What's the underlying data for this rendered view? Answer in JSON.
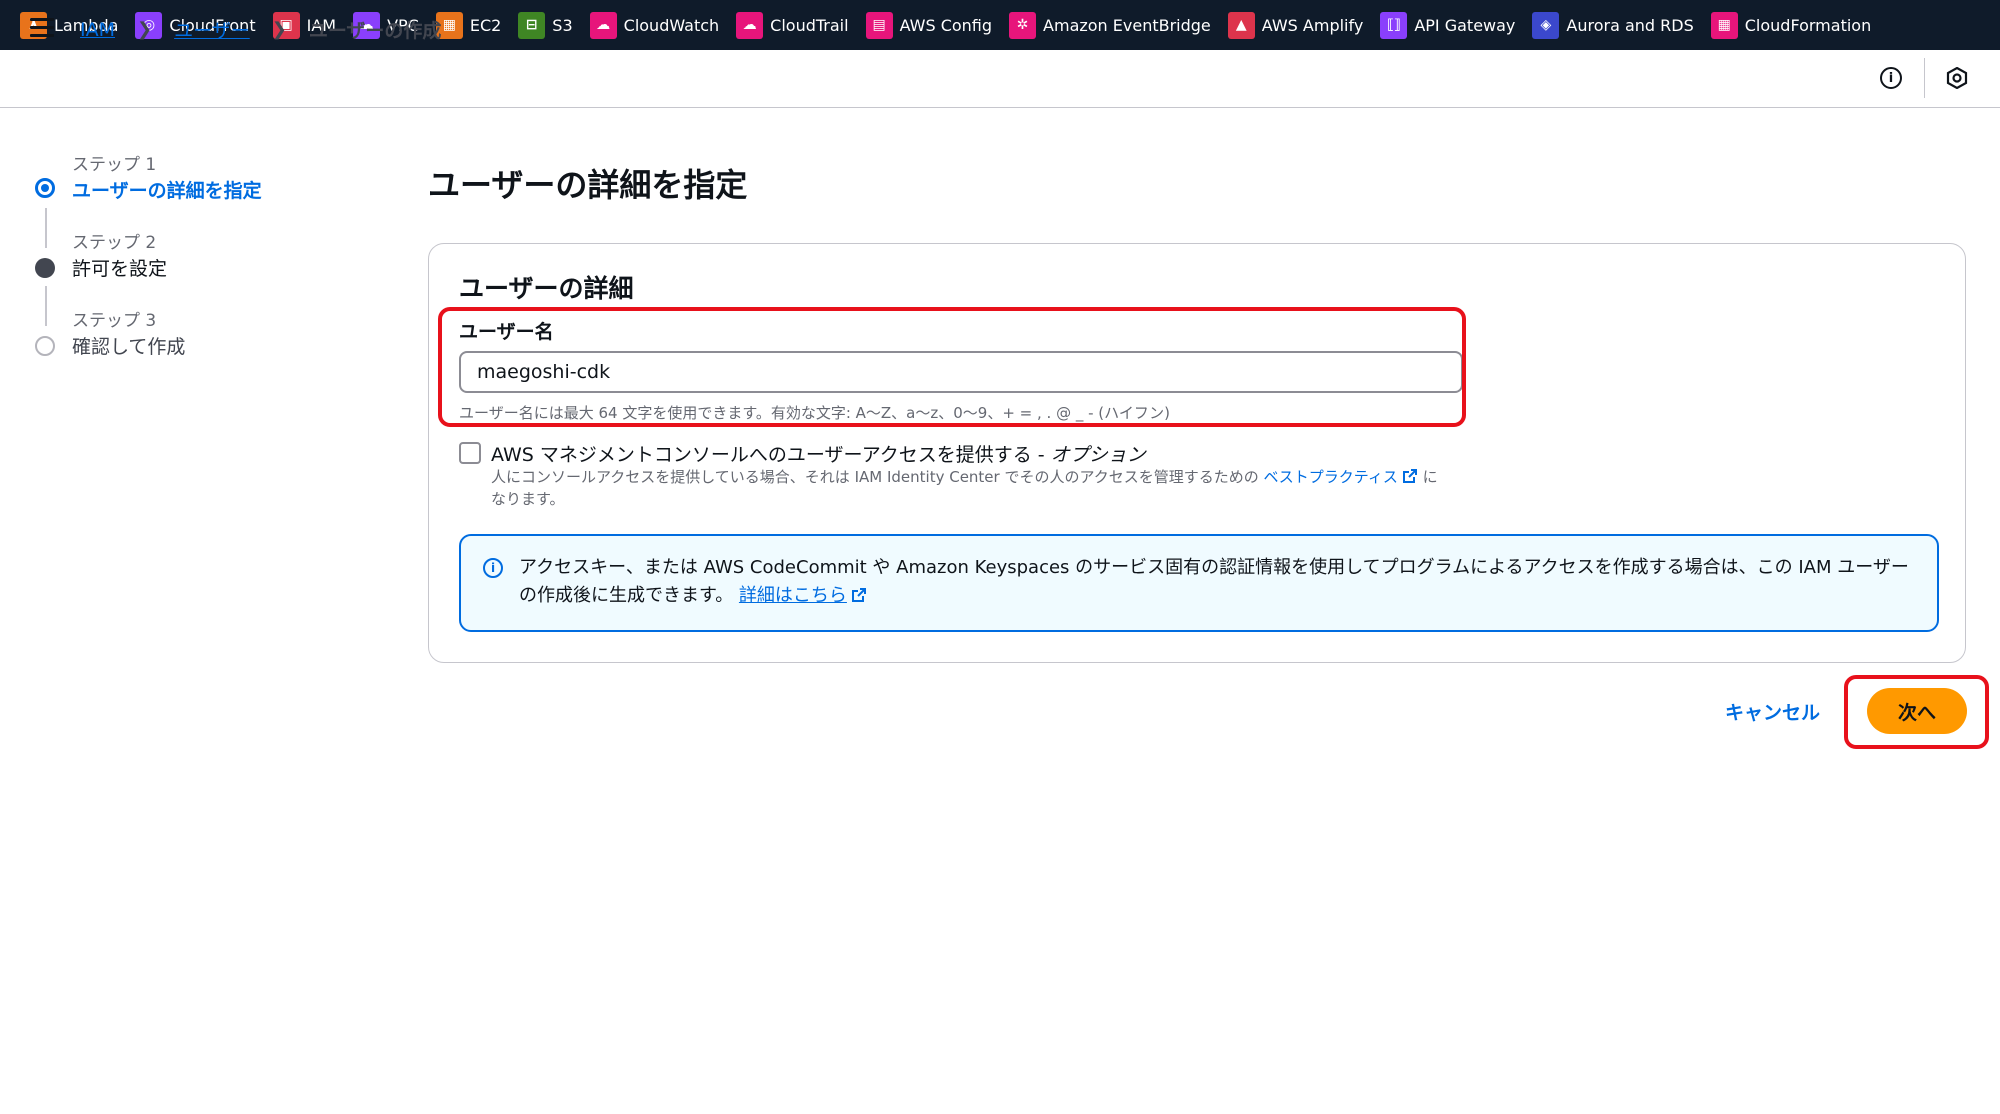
{
  "services": [
    {
      "name": "lambda",
      "label": "Lambda",
      "color": "#e8731b",
      "glyph": "λ"
    },
    {
      "name": "cloudfront",
      "label": "CloudFront",
      "color": "#8a3ffc",
      "glyph": "◎"
    },
    {
      "name": "iam",
      "label": "IAM",
      "color": "#dd344c",
      "glyph": "▣"
    },
    {
      "name": "vpc",
      "label": "VPC",
      "color": "#8a3ffc",
      "glyph": "☁"
    },
    {
      "name": "ec2",
      "label": "EC2",
      "color": "#e8731b",
      "glyph": "▦"
    },
    {
      "name": "s3",
      "label": "S3",
      "color": "#3f8624",
      "glyph": "⊟"
    },
    {
      "name": "cloudwatch",
      "label": "CloudWatch",
      "color": "#e7157b",
      "glyph": "☁"
    },
    {
      "name": "cloudtrail",
      "label": "CloudTrail",
      "color": "#e7157b",
      "glyph": "☁"
    },
    {
      "name": "aws-config",
      "label": "AWS Config",
      "color": "#e7157b",
      "glyph": "▤"
    },
    {
      "name": "eventbridge",
      "label": "Amazon EventBridge",
      "color": "#e7157b",
      "glyph": "✲"
    },
    {
      "name": "amplify",
      "label": "AWS Amplify",
      "color": "#dd344c",
      "glyph": "▲"
    },
    {
      "name": "api-gateway",
      "label": "API Gateway",
      "color": "#8a3ffc",
      "glyph": "⟦⟧"
    },
    {
      "name": "aurora-rds",
      "label": "Aurora and RDS",
      "color": "#3b48cc",
      "glyph": "◈"
    },
    {
      "name": "cloudformation",
      "label": "CloudFormation",
      "color": "#e7157b",
      "glyph": "▦"
    }
  ],
  "breadcrumb": {
    "iam": "IAM",
    "users": "ユーザー",
    "current": "ユーザーの作成"
  },
  "steps": [
    {
      "num": "ステップ 1",
      "title": "ユーザーの詳細を指定",
      "state": "active"
    },
    {
      "num": "ステップ 2",
      "title": "許可を設定",
      "state": "filled"
    },
    {
      "num": "ステップ 3",
      "title": "確認して作成",
      "state": "empty"
    }
  ],
  "main": {
    "page_title": "ユーザーの詳細を指定",
    "container_title": "ユーザーの詳細",
    "username_label": "ユーザー名",
    "username_value": "maegoshi-cdk",
    "username_constraint": "ユーザー名には最大 64 文字を使用できます。有効な文字: A〜Z、a〜z、0〜9、+ = , . @ _ - (ハイフン)",
    "console_access_label": "AWS マネジメントコンソールへのユーザーアクセスを提供する - ",
    "console_access_optional": "オプション",
    "console_access_desc": "人にコンソールアクセスを提供している場合、それは IAM Identity Center でその人のアクセスを管理するための ",
    "best_practice_link": "ベストプラクティス",
    "console_access_desc_end": " になります。",
    "alert_text": "アクセスキー、または AWS CodeCommit や Amazon Keyspaces のサービス固有の認証情報を使用してプログラムによるアクセスを作成する場合は、この IAM ユーザーの作成後に生成できます。 ",
    "alert_link": "詳細はこちら"
  },
  "actions": {
    "cancel": "キャンセル",
    "next": "次へ"
  },
  "colors": {
    "link": "#006ce0",
    "primary_button": "#ff9900",
    "highlight": "#e8111b",
    "topbar": "#0f1b2a"
  }
}
